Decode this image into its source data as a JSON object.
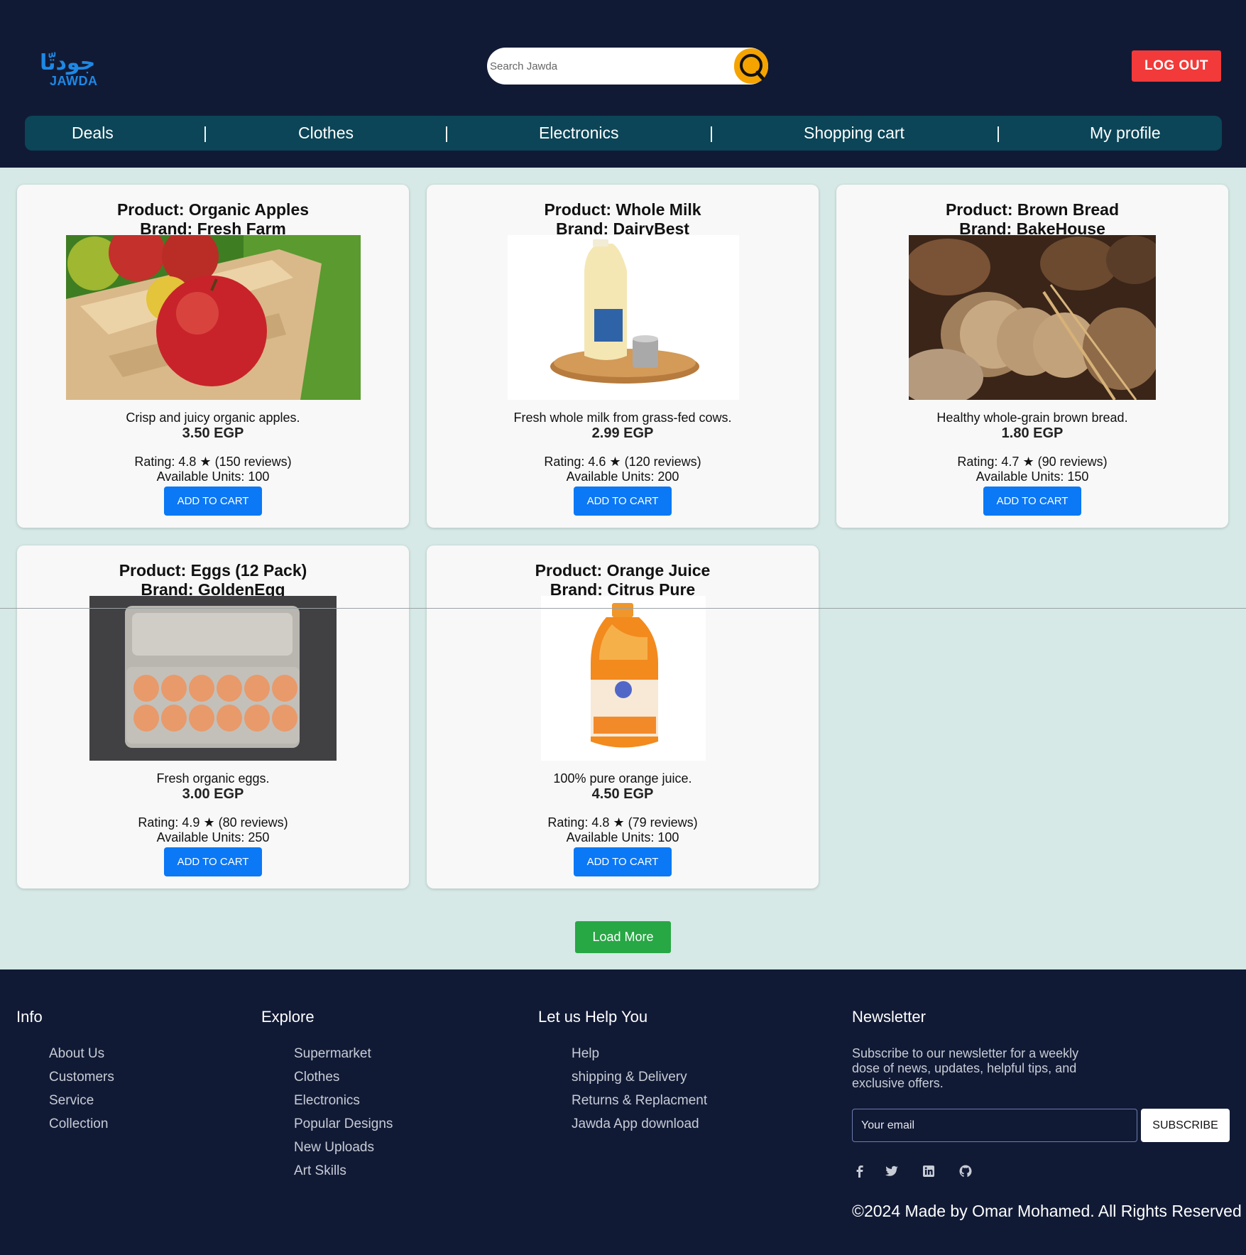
{
  "brand": {
    "arabic": "جودتّا",
    "latin": "JAWDA"
  },
  "search": {
    "placeholder": "Search Jawda"
  },
  "header": {
    "logout_label": "LOG OUT"
  },
  "nav": {
    "items": [
      "Deals",
      "Clothes",
      "Electronics",
      "Shopping cart",
      "My profile"
    ],
    "separator": "|"
  },
  "products": [
    {
      "title": "Product: Organic Apples",
      "brand": "Brand: Fresh Farm",
      "description": "Crisp and juicy organic apples.",
      "price": "3.50 EGP",
      "rating": "Rating: 4.8 ★ (150 reviews)",
      "units": "Available Units: 100",
      "button": "ADD TO CART"
    },
    {
      "title": "Product: Whole Milk",
      "brand": "Brand: DairyBest",
      "description": "Fresh whole milk from grass-fed cows.",
      "price": "2.99 EGP",
      "rating": "Rating: 4.6 ★ (120 reviews)",
      "units": "Available Units: 200",
      "button": "ADD TO CART"
    },
    {
      "title": "Product: Brown Bread",
      "brand": "Brand: BakeHouse",
      "description": "Healthy whole-grain brown bread.",
      "price": "1.80 EGP",
      "rating": "Rating: 4.7 ★ (90 reviews)",
      "units": "Available Units: 150",
      "button": "ADD TO CART"
    },
    {
      "title": "Product: Eggs (12 Pack)",
      "brand": "Brand: GoldenEgg",
      "description": "Fresh organic eggs.",
      "price": "3.00 EGP",
      "rating": "Rating: 4.9 ★ (80 reviews)",
      "units": "Available Units: 250",
      "button": "ADD TO CART"
    },
    {
      "title": "Product: Orange Juice",
      "brand": "Brand: Citrus Pure",
      "description": "100% pure orange juice.",
      "price": "4.50 EGP",
      "rating": "Rating: 4.8 ★ (79 reviews)",
      "units": "Available Units: 100",
      "button": "ADD TO CART"
    }
  ],
  "load_more": "Load More",
  "footer": {
    "info": {
      "heading": "Info",
      "links": [
        "About Us",
        "Customers",
        "Service",
        "Collection"
      ]
    },
    "explore": {
      "heading": "Explore",
      "links": [
        "Supermarket",
        "Clothes",
        "Electronics",
        "Popular Designs",
        "New Uploads",
        "Art Skills"
      ]
    },
    "help": {
      "heading": "Let us Help You",
      "links": [
        "Help",
        "shipping & Delivery",
        "Returns & Replacment",
        "Jawda App download"
      ]
    },
    "newsletter": {
      "heading": "Newsletter",
      "text": "Subscribe to our newsletter for a weekly dose of news, updates, helpful tips, and exclusive offers.",
      "email_placeholder": "Your email",
      "subscribe_label": "SUBSCRIBE"
    },
    "social": [
      "facebook-icon",
      "twitter-icon",
      "linkedin-icon",
      "github-icon"
    ],
    "copyright": "©2024 Made by Omar Mohamed. All Rights Reserved"
  },
  "colors": {
    "header_bg": "#111a35",
    "nav_bg": "#0b4557",
    "page_bg": "#d6e9e6",
    "logout": "#f23a3a",
    "add_to_cart": "#0b78f5",
    "load_more": "#28a745",
    "search_button": "#f5a300"
  }
}
